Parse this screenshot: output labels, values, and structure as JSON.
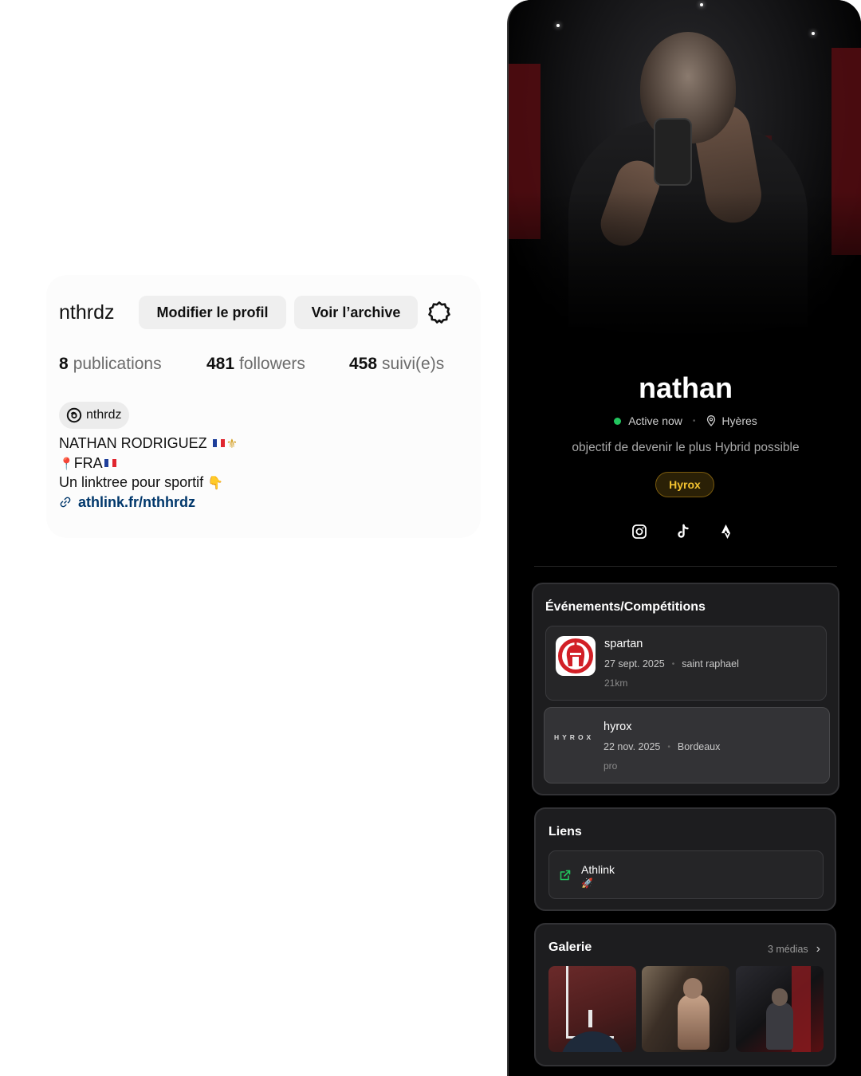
{
  "instagram": {
    "username": "nthrdz",
    "edit_button": "Modifier le profil",
    "archive_button": "Voir l’archive",
    "stats": [
      {
        "value": "8",
        "label": "publications"
      },
      {
        "value": "481",
        "label": "followers"
      },
      {
        "value": "458",
        "label": "suivi(e)s"
      }
    ],
    "threads_handle": "nthrdz",
    "bio_name": "NATHAN RODRIGUEZ",
    "bio_location": "FRA",
    "bio_line": "Un linktree pour sportif",
    "bio_link": "athlink.fr/nthhrdz"
  },
  "profile": {
    "name": "nathan",
    "status": "Active now",
    "location": "Hyères",
    "bio": "objectif de devenir le plus Hybrid possible",
    "tag": "Hyrox",
    "socials": [
      "instagram-icon",
      "tiktok-icon",
      "strava-icon"
    ],
    "colors": {
      "active": "#22c55e",
      "tag_text": "#f2c230",
      "background": "#000000"
    }
  },
  "events": {
    "title": "Événements/Compétitions",
    "items": [
      {
        "name": "spartan",
        "date": "27 sept. 2025",
        "place": "saint raphael",
        "detail": "21km"
      },
      {
        "name": "hyrox",
        "logo_text": "HYROX",
        "date": "22 nov. 2025",
        "place": "Bordeaux",
        "detail": "pro"
      }
    ]
  },
  "links": {
    "title": "Liens",
    "items": [
      {
        "label": "Athlink"
      }
    ]
  },
  "gallery": {
    "title": "Galerie",
    "count": "3 médias"
  }
}
